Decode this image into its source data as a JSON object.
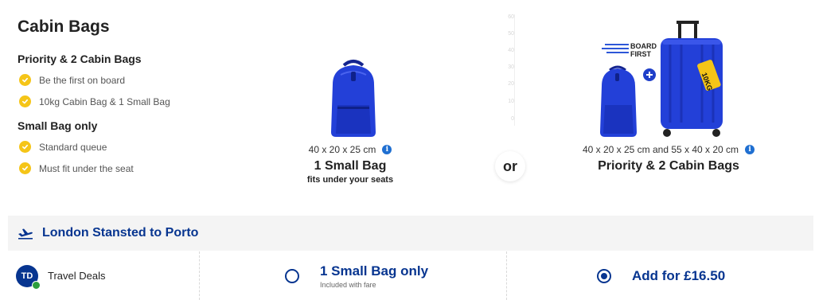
{
  "info": {
    "heading": "Cabin Bags",
    "priority": {
      "title": "Priority & 2 Cabin Bags",
      "features": [
        "Be the first on board",
        "10kg Cabin Bag & 1 Small Bag"
      ]
    },
    "small": {
      "title": "Small Bag only",
      "features": [
        "Standard queue",
        "Must fit under the seat"
      ]
    }
  },
  "axis_ticks": [
    "60",
    "50",
    "40",
    "30",
    "20",
    "10",
    "0"
  ],
  "small_option": {
    "dimensions": "40 x 20 x 25 cm",
    "name": "1 Small Bag",
    "subtitle": "fits under your seats"
  },
  "or_label": "or",
  "priority_option": {
    "dimensions": "40 x 20 x 25 cm and 55 x 40 x 20 cm",
    "name": "Priority & 2 Cabin Bags",
    "board_first_line1": "BOARD",
    "board_first_line2": "FIRST",
    "tag_label": "10KG"
  },
  "route": {
    "title": "London Stansted to Porto"
  },
  "fare_row": {
    "badge": "TD",
    "label": "Travel Deals",
    "small_bag_title": "1 Small Bag only",
    "small_bag_sub": "Included with fare",
    "add_label": "Add for £16.50",
    "selected": "priority"
  },
  "colors": {
    "brand_blue": "#073590",
    "accent_yellow": "#f5c518",
    "bag_blue": "#2340d8"
  },
  "info_icon_glyph": "i"
}
